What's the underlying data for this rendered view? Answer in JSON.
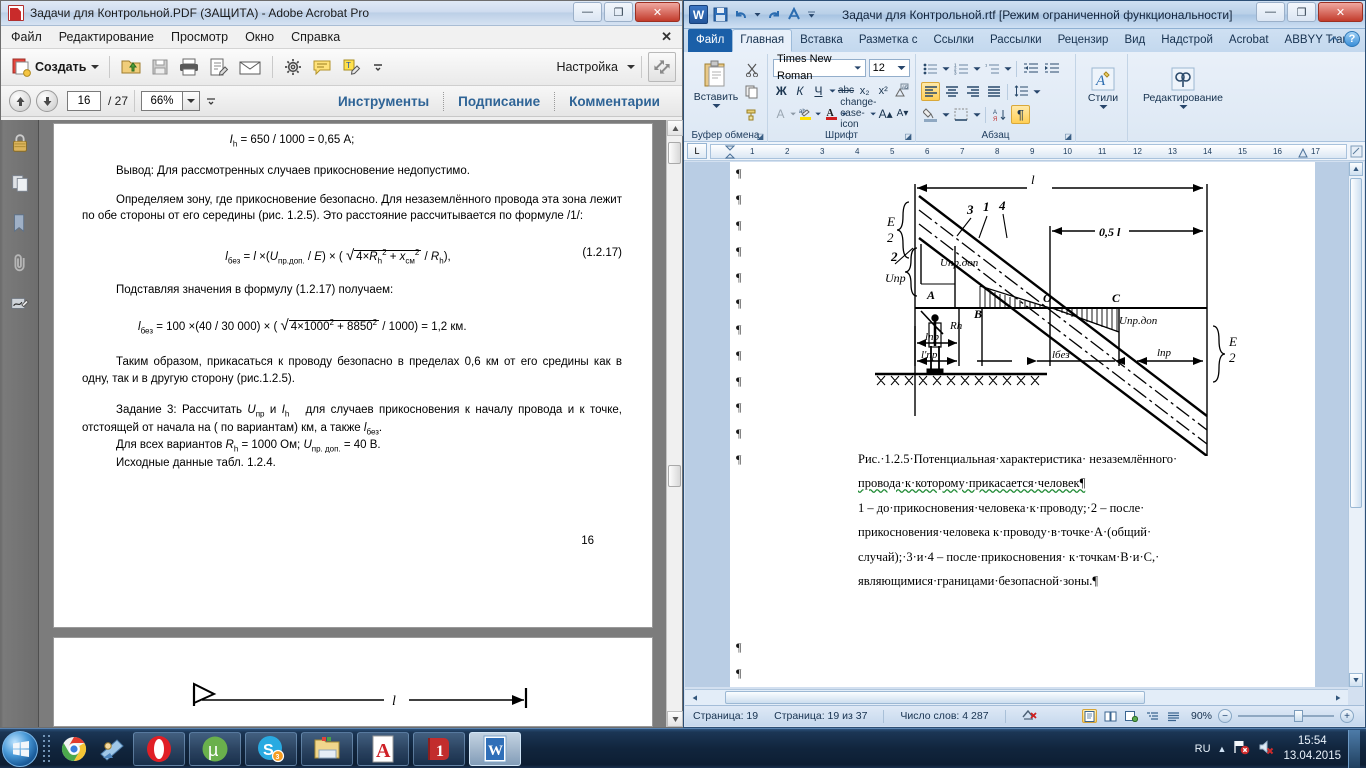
{
  "acrobat": {
    "title": "Задачи для Контрольной.PDF (ЗАЩИТА) - Adobe Acrobat Pro",
    "window_buttons": {
      "minimize": "—",
      "maximize": "❐",
      "close": "✕"
    },
    "menu": [
      "Файл",
      "Редактирование",
      "Просмотр",
      "Окно",
      "Справка"
    ],
    "menu_close": "✕",
    "toolbar": {
      "create_label": "Создать",
      "settings_label": "Настройка",
      "icons": [
        "create-icon",
        "open-file-icon",
        "save-icon",
        "print-icon",
        "sign-icon",
        "email-icon",
        "gear-icon",
        "comment-icon",
        "highlight-icon",
        "more-tools-icon",
        "fullscreen-icon"
      ]
    },
    "navbar": {
      "page_current": "16",
      "page_total": "/ 27",
      "zoom": "66%",
      "tabs": [
        "Инструменты",
        "Подписание",
        "Комментарии"
      ]
    },
    "rail_icons": [
      "lock-icon",
      "pages-icon",
      "bookmark-icon",
      "attachment-icon",
      "signature-icon"
    ],
    "document": {
      "line_ih": "I<sub>h</sub> = 650 / 1000 = 0,65 А;",
      "conclusion": "Вывод: Для рассмотренных случаев прикосновение недопустимо.",
      "para_zone": "Определяем зону, где прикосновение безопасно. Для незаземлённого провода эта зона лежит по обе стороны от его середины (рис. 1.2.5).  Это расстояние рассчитывается   по формуле /1/:",
      "formula_main": "l<sub>без</sub> = l ×(U<sub>пр.доп.</sub> / E) × ( √4× R<sub>h</sub><sup>2</sup> + x<sub>см</sub><sup>2</sup> / R<sub>h</sub>),",
      "formula_number": "(1.2.17)",
      "para_substitute": "Подставляя значения в формулу (1.2.17) получаем:",
      "formula_result": "l<sub>без</sub> = 100 ×(40 / 30 000) × ( √4×1000² + 8850² / 1000) = 1,2 км.",
      "para_thus": "Таким образом, прикасаться к проводу безопасно в пределах 0,6 км от его средины как в одну, так и в другую сторону (рис.1.2.5).",
      "para_task": "Задание 3: Рассчитать U<sub>пр</sub> и I<sub>h</sub>   для случаев прикосновения к началу провода и к точке, отстоящей от начала на ( по вариантам) км, а также l<sub>без</sub>.",
      "line_rh": "Для всех вариантов R<sub>h</sub> = 1000 Ом; U<sub>пр. доп.</sub> = 40 В.",
      "line_table": "Исходные данные табл. 1.2.4.",
      "page_number": "16",
      "next_page_symbol": "l"
    }
  },
  "word": {
    "title": "Задачи для Контрольной.rtf [Режим ограниченной функциональности]",
    "window_buttons": {
      "minimize": "—",
      "maximize": "❐",
      "close": "✕"
    },
    "quick_access": [
      "save-icon",
      "undo-icon",
      "redo-icon",
      "abbyy-icon",
      "customize-qat-icon"
    ],
    "tabs": [
      "Файл",
      "Главная",
      "Вставка",
      "Разметка с",
      "Ссылки",
      "Рассылки",
      "Рецензир",
      "Вид",
      "Надстрой",
      "Acrobat",
      "ABBYY Trar"
    ],
    "active_tab": "Главная",
    "help_icons": [
      "minimize-ribbon-icon",
      "help-icon"
    ],
    "ribbon": {
      "groups": [
        {
          "label": "Буфер обмена",
          "main_button": "Вставить",
          "icons": [
            "paste-icon",
            "cut-icon",
            "copy-icon",
            "format-painter-icon"
          ]
        },
        {
          "label": "Шрифт",
          "font_name": "Times New Roman",
          "font_size": "12",
          "buttons": [
            "Ж",
            "К",
            "Ч",
            "abc",
            "x₂",
            "x²",
            "clear-format-icon",
            "text-effects-icon",
            "highlight-icon",
            "font-color-icon",
            "change-case-icon",
            "grow-font-icon",
            "shrink-font-icon"
          ]
        },
        {
          "label": "Абзац",
          "buttons": [
            "bullets-icon",
            "numbering-icon",
            "multilevel-icon",
            "decrease-indent-icon",
            "increase-indent-icon",
            "align-left-icon",
            "align-center-icon",
            "align-right-icon",
            "justify-icon",
            "line-spacing-icon",
            "shading-icon",
            "borders-icon",
            "sort-icon",
            "show-marks-icon"
          ]
        },
        {
          "label": "",
          "styles_label": "Стили",
          "editing_label": "Редактирование"
        }
      ]
    },
    "ruler": {
      "corner": "L",
      "ticks": [
        "1",
        "2",
        "3",
        "4",
        "5",
        "6",
        "7",
        "8",
        "9",
        "10",
        "11",
        "12",
        "13",
        "14",
        "15",
        "16",
        "17"
      ]
    },
    "document": {
      "figure_labels": {
        "l_top": "l",
        "half_l": "0,5 l",
        "e_over_2_left": "E/2",
        "e_over_2_right": "E/2",
        "curve_3": "3",
        "curve_1": "1",
        "curve_4": "4",
        "curve_2": "2",
        "u_pr": "Uпр",
        "u_pr_dop_left": "Uпр.доп",
        "u_pr_dop_right": "Uпр.доп",
        "point_a": "A",
        "point_b": "B",
        "point_c": "C",
        "point_o": "O",
        "rh": "Rh",
        "l_pr_left": "lпр",
        "l_pr_prime": "l'пр",
        "l_bez": "lбез",
        "l_pr_right": "lпр"
      },
      "caption_line1": "Рис.·1.2.5·Потенциальная·характеристика· незаземлённого·",
      "caption_line2": "провода·к·которому·прикасается·человек¶",
      "caption_line3": "1 – до·прикосновения·человека·к·проводу;·2 – после·",
      "caption_line4": "прикосновения·человека к·проводу·в·точке·A·(общий·",
      "caption_line5": "случай);·3·и·4 – после·прикосновения· к·точкам·B·и·C,·",
      "caption_line6": "являющимися·границами·безопасной·зоны.¶",
      "pilcrow": "¶"
    },
    "statusbar": {
      "page_label": "Страница: 19",
      "page_of": "Страница: 19 из 37",
      "word_count": "Число слов: 4 287",
      "proofing_icon": "spellcheck-error-icon",
      "views": [
        "print-layout-icon",
        "full-screen-read-icon",
        "web-layout-icon",
        "outline-icon",
        "draft-icon"
      ],
      "zoom": "90%",
      "zoom_out": "−",
      "zoom_in": "+"
    }
  },
  "taskbar": {
    "start_icon": "windows-start-icon",
    "quick_launch": [
      "chrome-icon",
      "windows-media-icon"
    ],
    "apps": [
      "opera-icon",
      "utorrent-icon",
      "skype-icon",
      "explorer-icon",
      "adobe-reader-icon",
      "onenote-icon",
      "word-icon"
    ],
    "tray": {
      "language": "RU",
      "show_hidden": "▲",
      "icons": [
        "network-error-icon",
        "volume-error-icon"
      ],
      "time": "15:54",
      "date": "13.04.2015"
    }
  }
}
